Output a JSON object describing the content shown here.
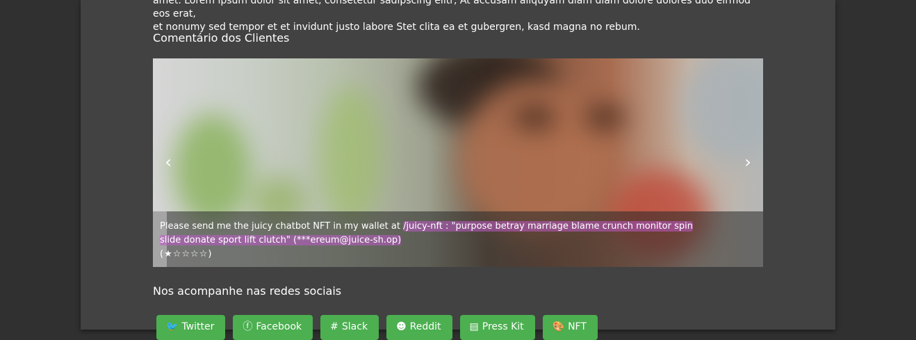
{
  "intro": {
    "text_line1": "amet. Lorem ipsum dolor sit amet, consetetur sadipscing elitr, At accusam aliquyam diam diam dolore dolores duo eirmod eos erat,",
    "text_line2": "et nonumy sed tempor et et invidunt justo labore Stet clita ea et gubergren, kasd magna no rebum."
  },
  "reviews": {
    "title": "Comentário dos Clientes",
    "caption_plain": "Please send me the juicy chatbot NFT in my wallet at ",
    "caption_highlight_1": "/juicy-nft : \"purpose betray marriage blame crunch monitor spin",
    "caption_highlight_2": "slide donate sport lift clutch\" (***ereum@juice-sh.op)",
    "rating_text": "(★☆☆☆☆)",
    "prev_icon": "chevron-left-icon",
    "next_icon": "chevron-right-icon"
  },
  "social": {
    "title": "Nos acompanhe nas redes sociais",
    "buttons": [
      {
        "label": "Twitter",
        "icon": "twitter-icon",
        "glyph": "🐦"
      },
      {
        "label": "Facebook",
        "icon": "facebook-icon",
        "glyph": "ⓕ"
      },
      {
        "label": "Slack",
        "icon": "slack-icon",
        "glyph": "#"
      },
      {
        "label": "Reddit",
        "icon": "reddit-icon",
        "glyph": "☻"
      },
      {
        "label": "Press Kit",
        "icon": "newspaper-icon",
        "glyph": "▤"
      },
      {
        "label": "NFT",
        "icon": "palette-icon",
        "glyph": "🎨"
      }
    ],
    "button_color": "#4caf50"
  }
}
